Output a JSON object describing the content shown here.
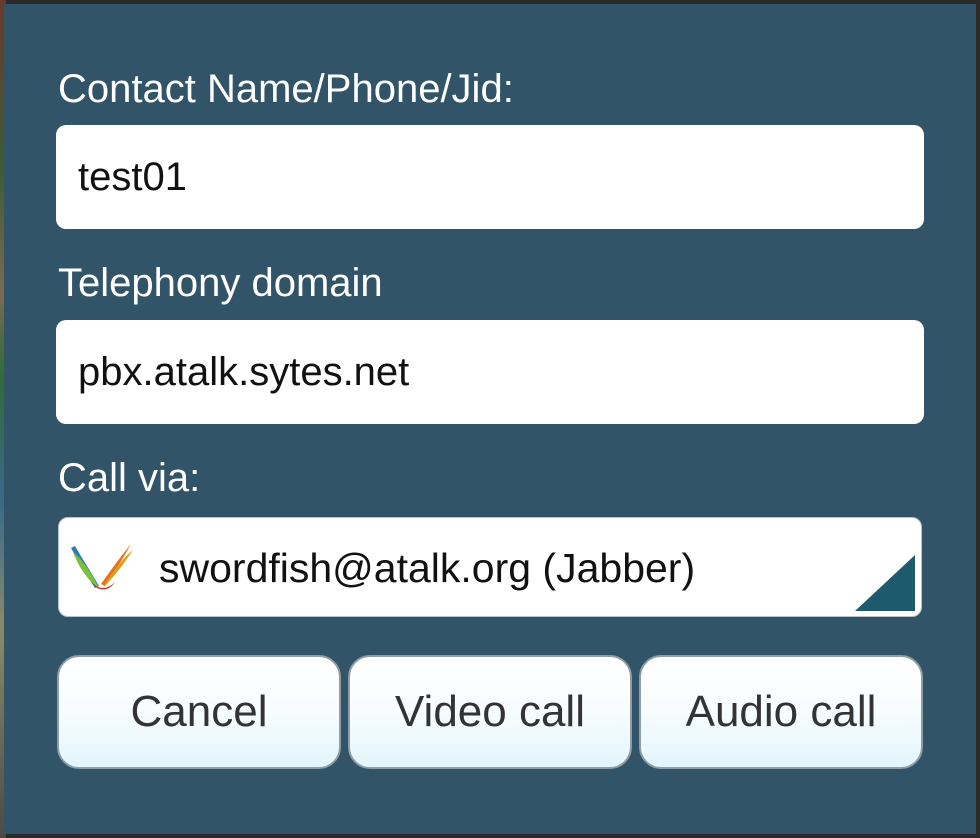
{
  "dialog": {
    "contact_label": "Contact Name/Phone/Jid:",
    "contact_value": "test01",
    "domain_label": "Telephony domain",
    "domain_value": "pbx.atalk.sytes.net",
    "call_via_label": "Call via:",
    "call_via_value": "swordfish@atalk.org (Jabber)",
    "call_via_icon": "jabber-logo-icon"
  },
  "buttons": {
    "cancel": "Cancel",
    "video": "Video call",
    "audio": "Audio call"
  },
  "colors": {
    "dialog_bg": "#325468",
    "spinner_corner": "#1d5a6e"
  }
}
